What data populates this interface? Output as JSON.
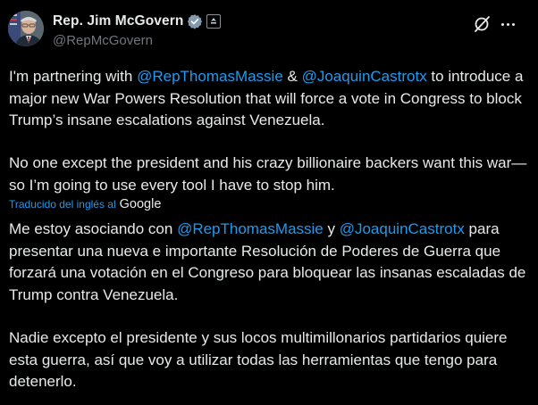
{
  "author": {
    "display_name": "Rep. Jim McGovern",
    "handle": "@RepMcGovern"
  },
  "icons": {
    "verified": "verified-badge-icon",
    "government": "government-affiliation-icon",
    "grok": "grok-icon",
    "more": "more-options-icon"
  },
  "colors": {
    "link": "#1d9bf0",
    "text": "#e7e9ea",
    "muted": "#71767b",
    "background": "#000000"
  },
  "original": {
    "p1": {
      "part1": "I'm partnering with ",
      "mention1": "@RepThomasMassie",
      "part2": " & ",
      "mention2": "@JoaquinCastrotx",
      "part3": " to introduce a major new War Powers Resolution that will force a vote in Congress to block Trump’s insane escalations against Venezuela."
    },
    "p2": "No one except the president and his crazy billionaire backers want this war—so I’m going to use every tool I have to stop him."
  },
  "translation": {
    "label": "Traducido del inglés al",
    "provider": "Google",
    "p1": {
      "part1": "Me estoy asociando con ",
      "mention1": "@RepThomasMassie",
      "part2": " y ",
      "mention2": "@JoaquinCastrotx",
      "part3": " para presentar una nueva e importante Resolución de Poderes de Guerra que forzará una votación en el Congreso para bloquear las insanas escaladas de Trump contra Venezuela."
    },
    "p2": "Nadie excepto el presidente y sus locos multimillonarios partidarios quiere esta guerra, así que voy a utilizar todas las herramientas que tengo para detenerlo."
  }
}
